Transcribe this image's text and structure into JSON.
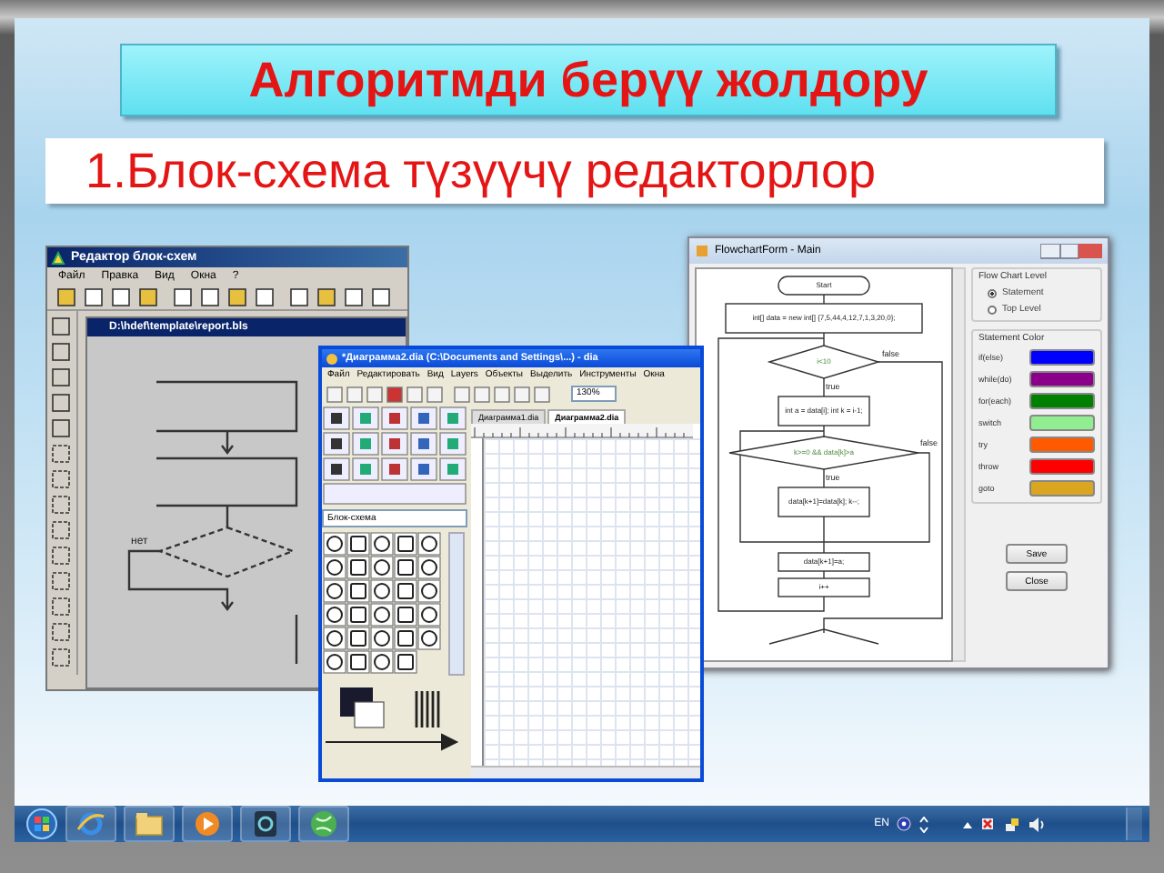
{
  "title": "Алгоритмди берүү жолдору",
  "subtitle": "1.Блок-схема түзүүчү редакторлор",
  "block_editor": {
    "title": "Редактор блок-схем",
    "menu": [
      "Файл",
      "Правка",
      "Вид",
      "Окна",
      "?"
    ],
    "document_title": "D:\\hdef\\template\\report.bls",
    "branch_label": "нет"
  },
  "dia_window": {
    "title": "*Диаграмма2.dia (C:\\Documents and Settings\\...) - dia",
    "menu": [
      "Файл",
      "Редактировать",
      "Вид",
      "Layers",
      "Объекты",
      "Выделить",
      "Инструменты",
      "Окна"
    ],
    "zoom": "130%",
    "sheet": "Блок-схема",
    "tabs": [
      {
        "label": "Диаграмма1.dia",
        "selected": false
      },
      {
        "label": "Диаграмма2.dia",
        "selected": true
      }
    ]
  },
  "flowchart_window": {
    "title": "FlowchartForm - Main",
    "nodes": [
      {
        "kind": "terminal",
        "text": "Start"
      },
      {
        "kind": "process",
        "text": "int[] data = new int[] {7,5,44,4,12,7,1,3,20,0};"
      },
      {
        "kind": "decision",
        "text": "i<10"
      },
      {
        "kind": "process",
        "text": "int a = data[i]; int k = i-1;"
      },
      {
        "kind": "decision",
        "text": "k>=0 && data[k]>a"
      },
      {
        "kind": "process",
        "text": "data[k+1]=data[k]; k--;"
      },
      {
        "kind": "process",
        "text": "data[k+1]=a;"
      },
      {
        "kind": "process",
        "text": "i++"
      }
    ],
    "edge_labels": [
      "false",
      "true",
      "false",
      "true"
    ],
    "level_group": "Flow Chart Level",
    "levels": [
      {
        "label": "Statement",
        "selected": true
      },
      {
        "label": "Top Level",
        "selected": false
      }
    ],
    "color_group": "Statement Color",
    "statement_colors": [
      {
        "label": "if(else)",
        "color": "#0000ff"
      },
      {
        "label": "while(do)",
        "color": "#8b008b"
      },
      {
        "label": "for(each)",
        "color": "#008000"
      },
      {
        "label": "switch",
        "color": "#90ee90"
      },
      {
        "label": "try",
        "color": "#ff5a00"
      },
      {
        "label": "throw",
        "color": "#ff0000"
      },
      {
        "label": "goto",
        "color": "#daa520"
      }
    ],
    "buttons": [
      "Save",
      "Close"
    ]
  },
  "taskbar": {
    "language": "EN"
  }
}
